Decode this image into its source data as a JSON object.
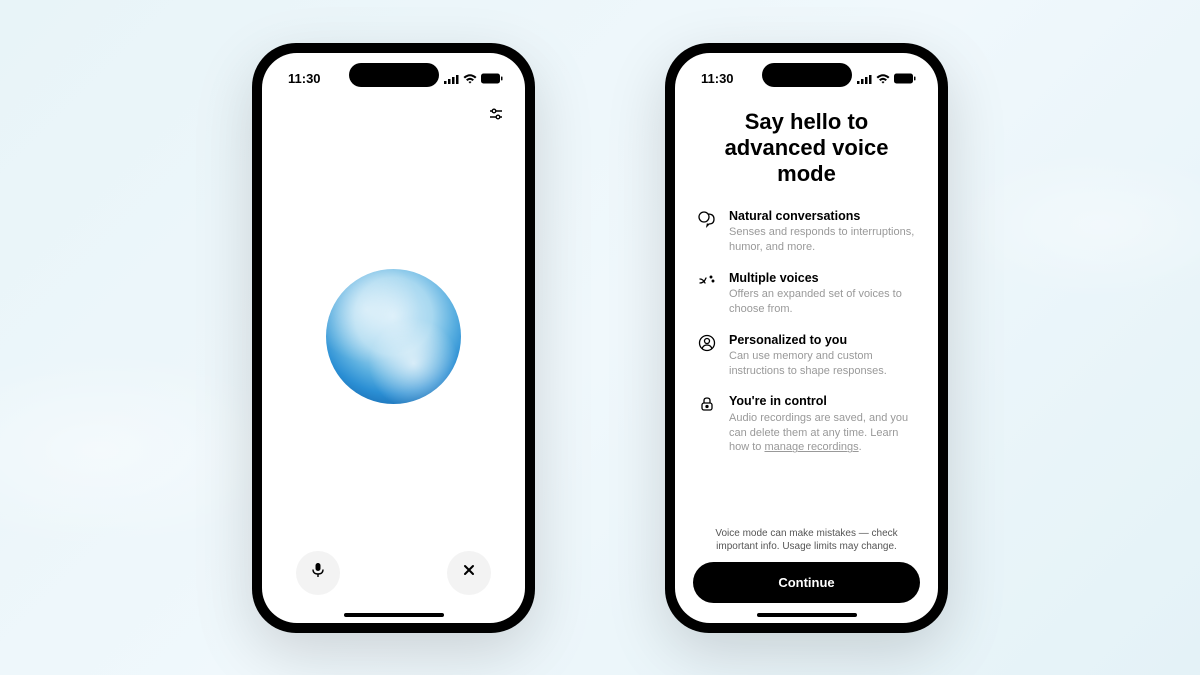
{
  "status": {
    "time": "11:30"
  },
  "phone1": {
    "icons": {
      "settings": "sliders-icon",
      "mic": "microphone-icon",
      "close": "close-icon"
    }
  },
  "phone2": {
    "title": "Say hello to advanced voice mode",
    "features": [
      {
        "icon": "chat-icon",
        "title": "Natural conversations",
        "desc": "Senses and responds to interruptions, humor, and more."
      },
      {
        "icon": "voices-icon",
        "title": "Multiple voices",
        "desc": "Offers an expanded set of voices to choose from."
      },
      {
        "icon": "person-icon",
        "title": "Personalized to you",
        "desc": "Can use memory and custom instructions to shape responses."
      },
      {
        "icon": "lock-icon",
        "title": "You're in control",
        "desc": "Audio recordings are saved, and you can delete them at any time. Learn how to ",
        "link": "manage recordings"
      }
    ],
    "disclaimer": "Voice mode can make mistakes — check important info. Usage limits may change.",
    "continue": "Continue"
  }
}
